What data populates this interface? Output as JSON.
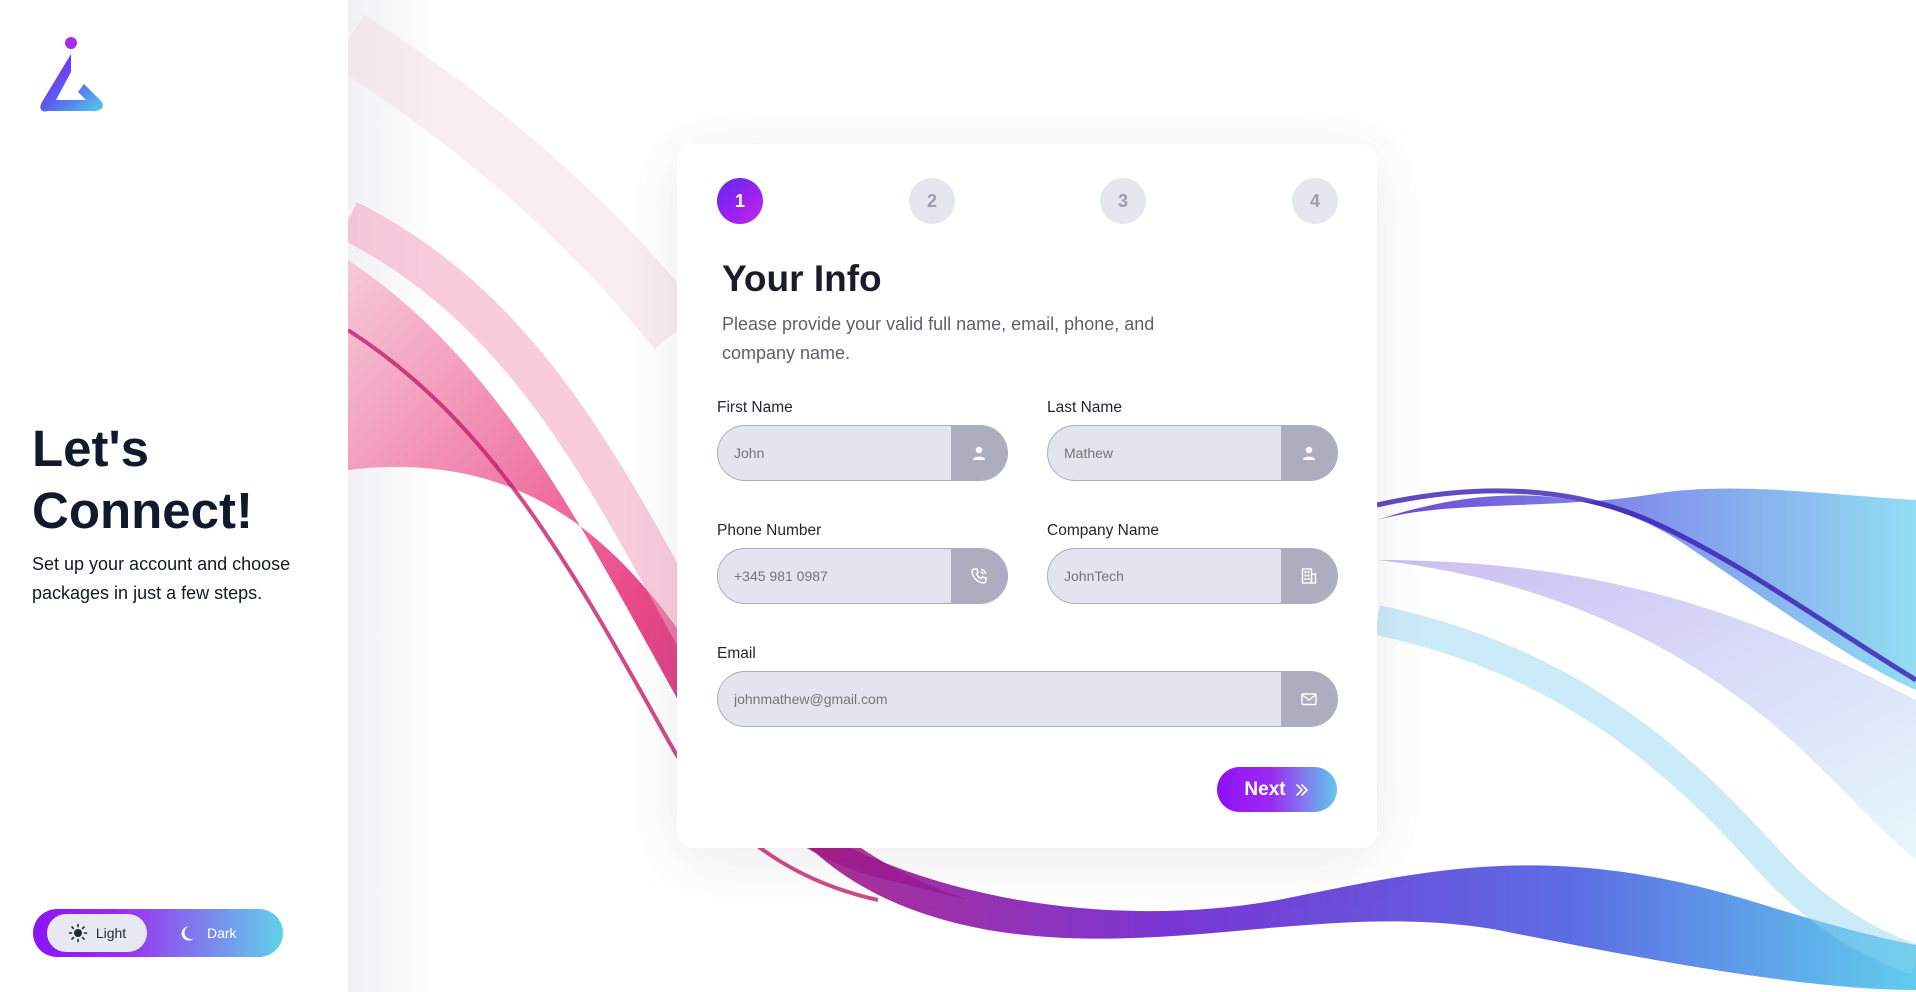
{
  "sidebar": {
    "logo_name": "app-logo",
    "title": "Let's Connect!",
    "subtitle": "Set up your account and choose packages in just a few steps.",
    "theme_toggle": {
      "light_label": "Light",
      "dark_label": "Dark",
      "selected": "Light"
    }
  },
  "stepper": {
    "steps": [
      "1",
      "2",
      "3",
      "4"
    ],
    "current": 1
  },
  "form": {
    "title": "Your Info",
    "description": "Please provide your valid full name, email, phone, and company name.",
    "first_name": {
      "label": "First Name",
      "placeholder": "John",
      "icon": "user-icon"
    },
    "last_name": {
      "label": "Last Name",
      "placeholder": "Mathew",
      "icon": "user-icon"
    },
    "phone": {
      "label": "Phone Number",
      "placeholder": "+345 981 0987",
      "icon": "phone-icon"
    },
    "company": {
      "label": "Company Name",
      "placeholder": "JohnTech",
      "icon": "building-icon"
    },
    "email": {
      "label": "Email",
      "placeholder": "johnmathew@gmail.com",
      "icon": "mail-icon"
    },
    "next_label": "Next"
  },
  "colors": {
    "accent_purple": "#8f0ff6",
    "accent_cyan": "#5fd2ea",
    "wave_pink": "#e8347a",
    "text_dark": "#0f1b2d",
    "field_bg": "#e3e5ee",
    "icon_bg": "#adadc0"
  }
}
